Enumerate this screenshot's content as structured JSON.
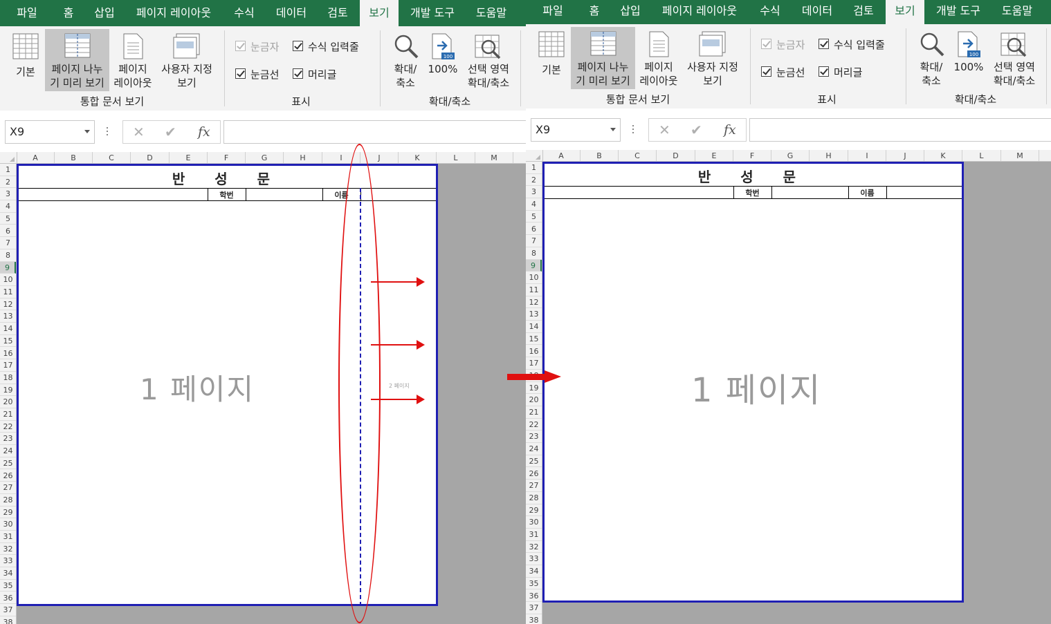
{
  "tabs": [
    "파일",
    "홈",
    "삽입",
    "페이지 레이아웃",
    "수식",
    "데이터",
    "검토",
    "보기",
    "개발 도구",
    "도움말"
  ],
  "active_tab": "보기",
  "ribbon": {
    "workbook_views": {
      "normal": "기본",
      "page_break_preview_l1": "페이지 나누",
      "page_break_preview_l2": "기 미리 보기",
      "page_layout_l1": "페이지",
      "page_layout_l2": "레이아웃",
      "custom_views_l1": "사용자 지정",
      "custom_views_l2": "보기",
      "group_label": "통합 문서 보기"
    },
    "show": {
      "ruler": "눈금자",
      "formula_bar": "수식 입력줄",
      "gridlines": "눈금선",
      "headings": "머리글",
      "group_label": "표시"
    },
    "zoom": {
      "zoom_l1": "확대/",
      "zoom_l2": "축소",
      "hundred": "100%",
      "hundred_icon_text": "100",
      "zoom_selection_l1": "선택 영역",
      "zoom_selection_l2": "확대/축소",
      "group_label": "확대/축소"
    }
  },
  "formula_bar": {
    "name_box": "X9",
    "cancel": "✕",
    "enter": "✔",
    "fx": "fx",
    "content": ""
  },
  "columns": [
    "A",
    "B",
    "C",
    "D",
    "E",
    "F",
    "G",
    "H",
    "I",
    "J",
    "K",
    "L",
    "M"
  ],
  "rows": [
    "1",
    "2",
    "3",
    "4",
    "5",
    "6",
    "7",
    "8",
    "9",
    "10",
    "11",
    "12",
    "13",
    "14",
    "15",
    "16",
    "17",
    "18",
    "19",
    "20",
    "21",
    "22",
    "23",
    "24",
    "25",
    "26",
    "27",
    "28",
    "29",
    "30",
    "31",
    "32",
    "33",
    "34",
    "35",
    "36",
    "37",
    "38"
  ],
  "selected_row": "9",
  "sheet": {
    "title": "반 성 문",
    "student_id_label": "학번",
    "name_label": "이름",
    "page1_watermark": "1 페이지",
    "page2_watermark": "2 페이지"
  },
  "colors": {
    "excel_green": "#217346",
    "page_border": "#1f1fb3",
    "annotation_red": "#e01010"
  }
}
